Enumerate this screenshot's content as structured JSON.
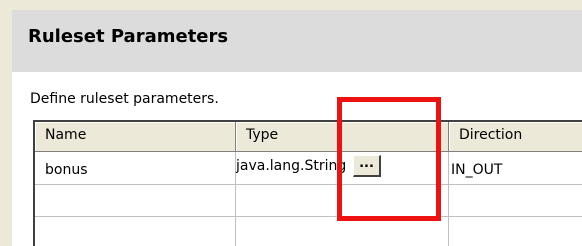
{
  "section": {
    "title": "Ruleset Parameters",
    "description": "Define ruleset parameters."
  },
  "grid": {
    "columns": [
      "Name",
      "Type",
      "Direction"
    ],
    "rows": [
      {
        "name": "bonus",
        "type": "java.lang.String",
        "direction": "IN_OUT"
      }
    ],
    "ellipsis_label": "..."
  },
  "colors": {
    "annotation": "#ee1111",
    "header_band": "#dcdcdc",
    "column_header": "#ece9d8"
  }
}
